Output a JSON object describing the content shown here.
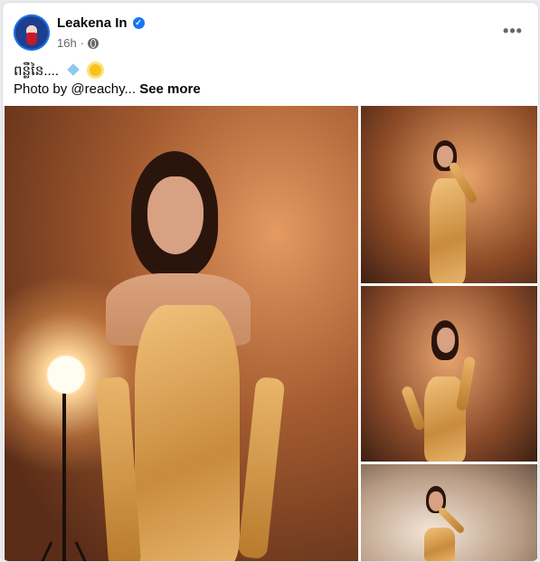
{
  "post": {
    "author": "Leakena In",
    "verified_icon": "verified-badge-icon",
    "time": "16h",
    "time_separator": "·",
    "audience_icon": "globe-icon",
    "more_label": "•••",
    "caption_line1": "ពន្លឺនៃ....",
    "caption_line2_prefix": "Photo by @reachy...",
    "see_more": "See more"
  },
  "colors": {
    "accent": "#1877f2",
    "text": "#050505",
    "secondary_text": "#65676b"
  }
}
